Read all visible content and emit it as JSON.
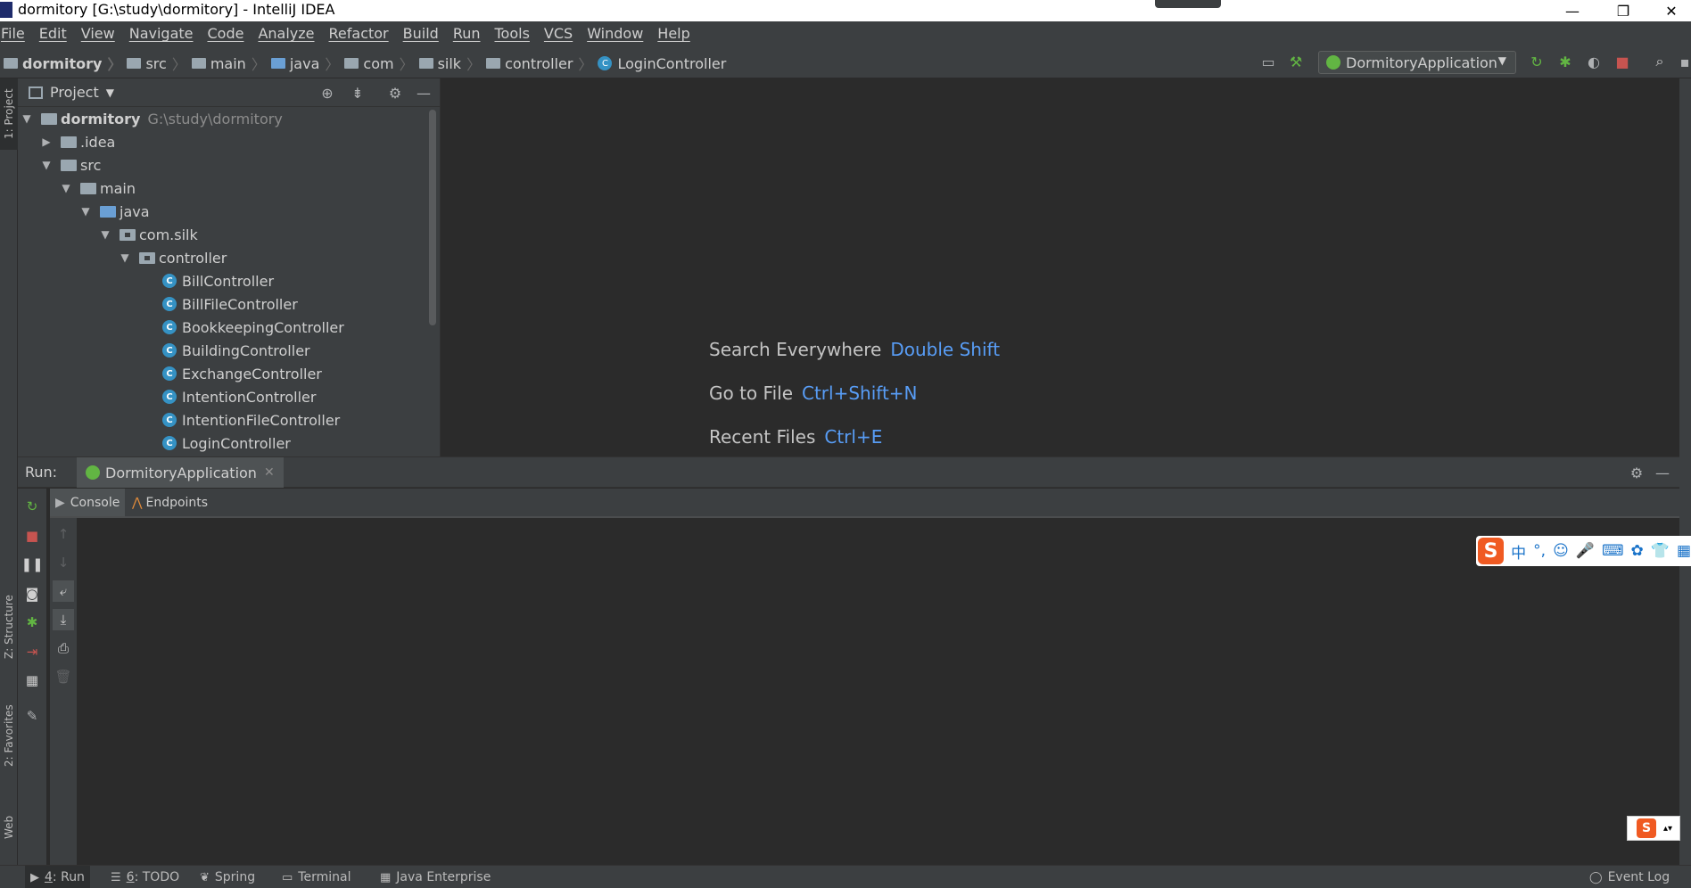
{
  "window": {
    "title": "dormitory [G:\\study\\dormitory] - IntelliJ IDEA",
    "minimize": "—",
    "restore": "❐",
    "close": "✕"
  },
  "menu": [
    "File",
    "Edit",
    "View",
    "Navigate",
    "Code",
    "Analyze",
    "Refactor",
    "Build",
    "Run",
    "Tools",
    "VCS",
    "Window",
    "Help"
  ],
  "breadcrumbs": [
    "dormitory",
    "src",
    "main",
    "java",
    "com",
    "silk",
    "controller",
    "LoginController"
  ],
  "run_config": {
    "name": "DormitoryApplication"
  },
  "side_tabs": {
    "project": "1: Project",
    "structure": "Z: Structure",
    "favorites": "2: Favorites",
    "web": "Web"
  },
  "project_panel": {
    "label": "Project",
    "tree": [
      {
        "name": "dormitory",
        "extra": "G:\\study\\dormitory",
        "kind": "module"
      },
      {
        "name": ".idea",
        "kind": "folder"
      },
      {
        "name": "src",
        "kind": "folder"
      },
      {
        "name": "main",
        "kind": "folder"
      },
      {
        "name": "java",
        "kind": "source"
      },
      {
        "name": "com.silk",
        "kind": "package"
      },
      {
        "name": "controller",
        "kind": "package"
      },
      {
        "name": "BillController",
        "kind": "class"
      },
      {
        "name": "BillFileController",
        "kind": "class"
      },
      {
        "name": "BookkeepingController",
        "kind": "class"
      },
      {
        "name": "BuildingController",
        "kind": "class"
      },
      {
        "name": "ExchangeController",
        "kind": "class"
      },
      {
        "name": "IntentionController",
        "kind": "class"
      },
      {
        "name": "IntentionFileController",
        "kind": "class"
      },
      {
        "name": "LoginController",
        "kind": "class"
      }
    ]
  },
  "editor_hints": [
    {
      "label": "Search Everywhere",
      "key": "Double Shift"
    },
    {
      "label": "Go to File",
      "key": "Ctrl+Shift+N"
    },
    {
      "label": "Recent Files",
      "key": "Ctrl+E"
    }
  ],
  "run_panel": {
    "label": "Run:",
    "tab": "DormitoryApplication",
    "subtabs": [
      "Console",
      "Endpoints"
    ]
  },
  "ime": {
    "logo": "S",
    "items": [
      "中",
      "°,",
      "☺",
      "🎤",
      "⌨",
      "✿",
      "👕",
      "▦"
    ]
  },
  "status_tabs": [
    {
      "num": "4",
      "label": ": Run"
    },
    {
      "num": "6",
      "label": ": TODO"
    },
    {
      "num": "",
      "label": "Spring"
    },
    {
      "num": "",
      "label": "Terminal"
    },
    {
      "num": "",
      "label": "Java Enterprise"
    }
  ],
  "event_log": "Event Log",
  "colors": {
    "accent_blue": "#589df6",
    "run_green": "#62b543",
    "stop_red": "#c75450",
    "class_blue": "#3592c4"
  }
}
